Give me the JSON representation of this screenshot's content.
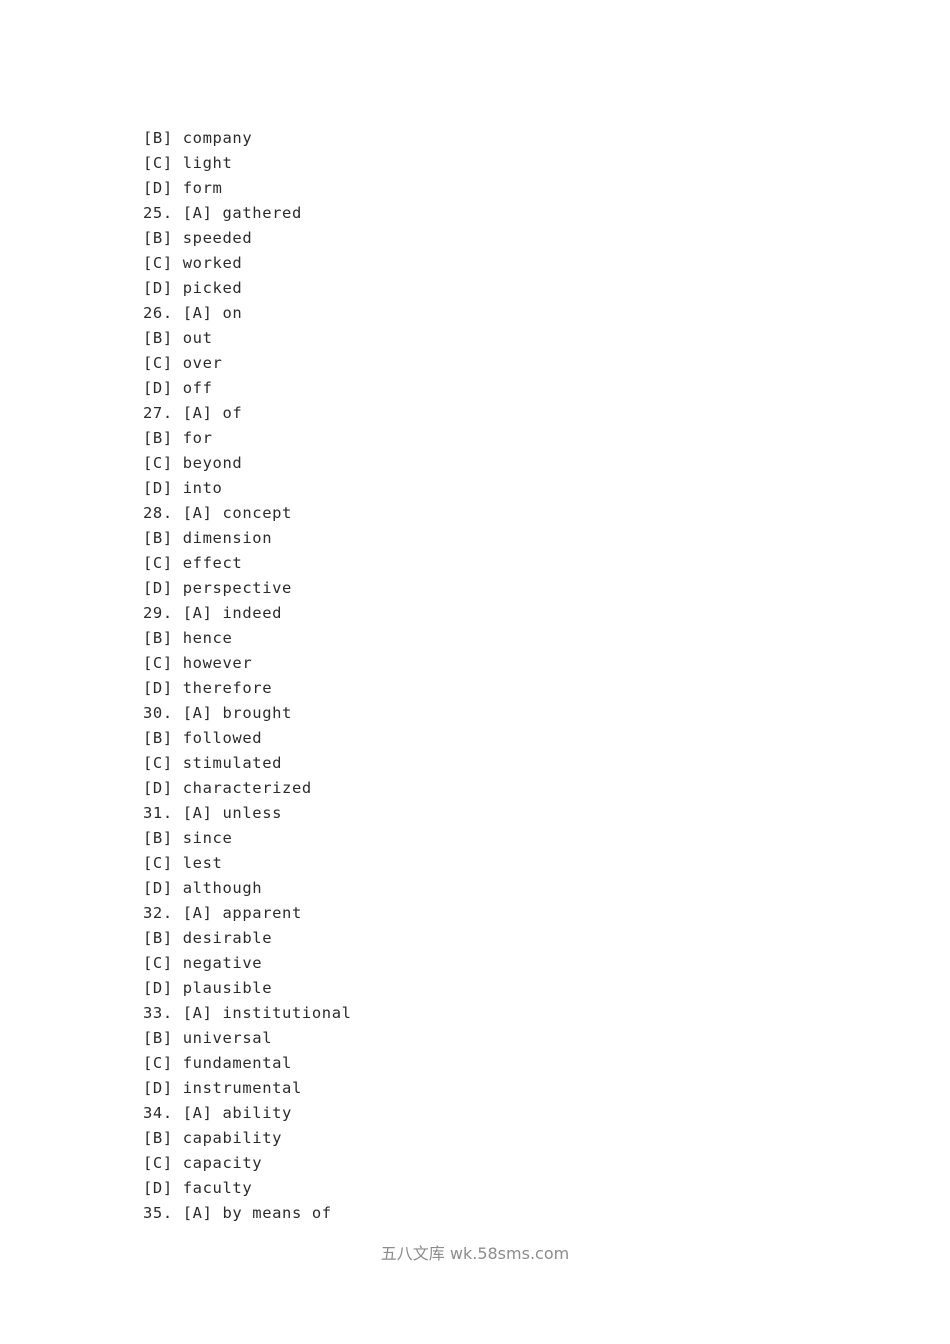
{
  "document": {
    "page_background": "#ffffff",
    "text_color": "#2b2b2b",
    "watermark_color": "#8c8c8c"
  },
  "options": [
    {
      "number": "",
      "tag": "[B]",
      "word": "company"
    },
    {
      "number": "",
      "tag": "[C]",
      "word": "light"
    },
    {
      "number": "",
      "tag": "[D]",
      "word": "form"
    },
    {
      "number": "25.",
      "tag": "[A]",
      "word": "gathered"
    },
    {
      "number": "",
      "tag": "[B]",
      "word": "speeded"
    },
    {
      "number": "",
      "tag": "[C]",
      "word": "worked"
    },
    {
      "number": "",
      "tag": "[D]",
      "word": "picked"
    },
    {
      "number": "26.",
      "tag": "[A]",
      "word": "on"
    },
    {
      "number": "",
      "tag": "[B]",
      "word": "out"
    },
    {
      "number": "",
      "tag": "[C]",
      "word": "over"
    },
    {
      "number": "",
      "tag": "[D]",
      "word": "off"
    },
    {
      "number": "27.",
      "tag": "[A]",
      "word": "of"
    },
    {
      "number": "",
      "tag": "[B]",
      "word": "for"
    },
    {
      "number": "",
      "tag": "[C]",
      "word": "beyond"
    },
    {
      "number": "",
      "tag": "[D]",
      "word": "into"
    },
    {
      "number": "28.",
      "tag": "[A]",
      "word": "concept"
    },
    {
      "number": "",
      "tag": "[B]",
      "word": "dimension"
    },
    {
      "number": "",
      "tag": "[C]",
      "word": "effect"
    },
    {
      "number": "",
      "tag": "[D]",
      "word": "perspective"
    },
    {
      "number": "29.",
      "tag": "[A]",
      "word": "indeed"
    },
    {
      "number": "",
      "tag": "[B]",
      "word": "hence"
    },
    {
      "number": "",
      "tag": "[C]",
      "word": "however"
    },
    {
      "number": "",
      "tag": "[D]",
      "word": "therefore"
    },
    {
      "number": "30.",
      "tag": "[A]",
      "word": "brought"
    },
    {
      "number": "",
      "tag": "[B]",
      "word": "followed"
    },
    {
      "number": "",
      "tag": "[C]",
      "word": "stimulated"
    },
    {
      "number": "",
      "tag": "[D]",
      "word": "characterized"
    },
    {
      "number": "31.",
      "tag": "[A]",
      "word": "unless"
    },
    {
      "number": "",
      "tag": "[B]",
      "word": "since"
    },
    {
      "number": "",
      "tag": "[C]",
      "word": "lest"
    },
    {
      "number": "",
      "tag": "[D]",
      "word": "although"
    },
    {
      "number": "32.",
      "tag": "[A]",
      "word": "apparent"
    },
    {
      "number": "",
      "tag": "[B]",
      "word": "desirable"
    },
    {
      "number": "",
      "tag": "[C]",
      "word": "negative"
    },
    {
      "number": "",
      "tag": "[D]",
      "word": "plausible"
    },
    {
      "number": "33.",
      "tag": "[A]",
      "word": "institutional"
    },
    {
      "number": "",
      "tag": "[B]",
      "word": "universal"
    },
    {
      "number": "",
      "tag": "[C]",
      "word": "fundamental"
    },
    {
      "number": "",
      "tag": "[D]",
      "word": "instrumental"
    },
    {
      "number": "34.",
      "tag": "[A]",
      "word": "ability"
    },
    {
      "number": "",
      "tag": "[B]",
      "word": "capability"
    },
    {
      "number": "",
      "tag": "[C]",
      "word": "capacity"
    },
    {
      "number": "",
      "tag": "[D]",
      "word": "faculty"
    },
    {
      "number": "35.",
      "tag": "[A]",
      "word": "by means of"
    }
  ],
  "watermark": {
    "text": "五八文库 wk.58sms.com"
  }
}
